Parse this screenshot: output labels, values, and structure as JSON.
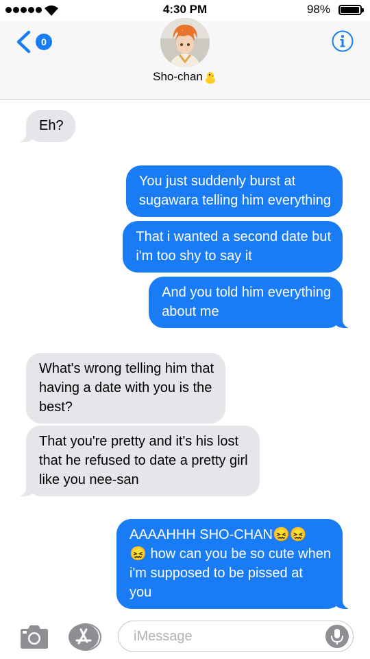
{
  "status": {
    "time": "4:30 PM",
    "battery_percent": "98%",
    "battery_level": 0.98
  },
  "header": {
    "back_badge": "0",
    "contact_name": "Sho-chan"
  },
  "messages": [
    {
      "side": "in",
      "text": "Eh?"
    },
    {
      "side": "out",
      "text": "You just suddenly burst at\nsugawara telling him everything"
    },
    {
      "side": "out",
      "text": "That i wanted a second date but\ni'm too shy to say it"
    },
    {
      "side": "out",
      "text": "And you told him everything\nabout me"
    },
    {
      "side": "in",
      "text": "What's wrong telling him that\nhaving a date with you is the\nbest?"
    },
    {
      "side": "in",
      "text": "That you're pretty and it's his lost\nthat he refused to date a pretty girl\nlike you nee-san"
    },
    {
      "side": "out",
      "text": "AAAAHHH SHO-CHAN😖😖\n😖 how can you be so cute when\ni'm supposed to be pissed at\nyou"
    }
  ],
  "input": {
    "placeholder": "iMessage"
  },
  "colors": {
    "outgoing": "#1a7cf5",
    "incoming": "#e5e5ea",
    "accent": "#1a7cf5"
  },
  "icons": [
    "wifi-icon",
    "battery-icon",
    "back-chevron-icon",
    "info-icon",
    "chick-emoji-icon",
    "camera-icon",
    "app-store-icon",
    "microphone-icon"
  ]
}
